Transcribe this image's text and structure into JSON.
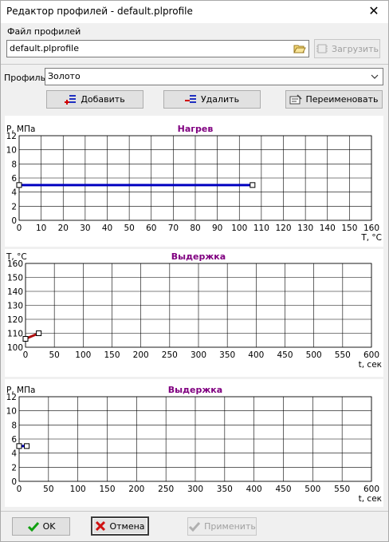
{
  "window": {
    "title": "Редактор профилей - default.plprofile"
  },
  "file": {
    "label": "Файл профилей",
    "value": "default.plprofile",
    "load_label": "Загрузить"
  },
  "profile": {
    "label": "Профиль",
    "value": "Золото"
  },
  "actions": {
    "add": "Добавить",
    "delete": "Удалить",
    "rename": "Переименовать"
  },
  "footer": {
    "ok": "OK",
    "cancel": "Отмена",
    "apply": "Применить"
  },
  "colors": {
    "series_blue": "#0000c0",
    "series_red": "#b01010",
    "title_purple": "#800080"
  },
  "chart_data": [
    {
      "type": "line",
      "title": "Нагрев",
      "ylabel": "P, МПа",
      "xlabel": "T, °C",
      "xlim": [
        0,
        160
      ],
      "ylim": [
        0,
        12
      ],
      "xticks": [
        0,
        10,
        20,
        30,
        40,
        50,
        60,
        70,
        80,
        90,
        100,
        110,
        120,
        130,
        140,
        150,
        160
      ],
      "yticks": [
        0,
        2,
        4,
        6,
        8,
        10,
        12
      ],
      "series": [
        {
          "x": [
            0,
            106
          ],
          "y": [
            5,
            5
          ]
        }
      ]
    },
    {
      "type": "line",
      "title": "Выдержка",
      "ylabel": "T, °C",
      "xlabel": "t, сек",
      "xlim": [
        0,
        600
      ],
      "ylim": [
        100,
        160
      ],
      "xticks": [
        0,
        50,
        100,
        150,
        200,
        250,
        300,
        350,
        400,
        450,
        500,
        550,
        600
      ],
      "yticks": [
        100,
        110,
        120,
        130,
        140,
        150,
        160
      ],
      "series": [
        {
          "x": [
            0,
            23
          ],
          "y": [
            106,
            110
          ]
        }
      ]
    },
    {
      "type": "line",
      "title": "Выдержка",
      "ylabel": "P, МПа",
      "xlabel": "t, сек",
      "xlim": [
        0,
        600
      ],
      "ylim": [
        0,
        12
      ],
      "xticks": [
        0,
        50,
        100,
        150,
        200,
        250,
        300,
        350,
        400,
        450,
        500,
        550,
        600
      ],
      "yticks": [
        0,
        2,
        4,
        6,
        8,
        10,
        12
      ],
      "series": [
        {
          "x": [
            0,
            13
          ],
          "y": [
            5,
            5
          ]
        }
      ]
    }
  ]
}
